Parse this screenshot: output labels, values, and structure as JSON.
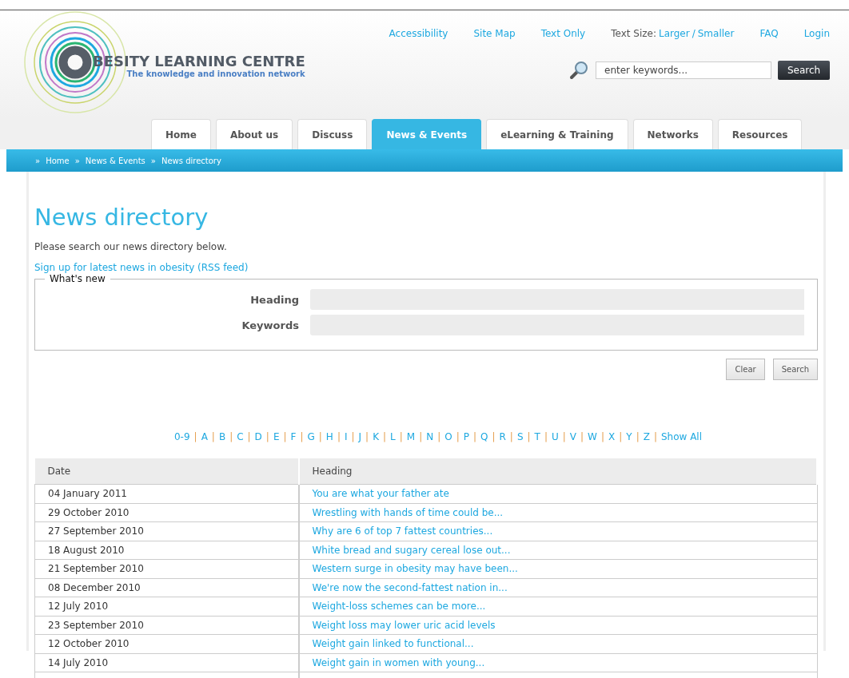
{
  "logo": {
    "name": "BESITY LEARNING CENTRE",
    "tagline": "The knowledge and innovation network"
  },
  "top_links": [
    {
      "kind": "link",
      "text": "Accessibility"
    },
    {
      "kind": "link",
      "text": "Site Map"
    },
    {
      "kind": "link",
      "text": "Text Only"
    },
    {
      "kind": "textsize",
      "text": "Text Size:",
      "larger": "Larger",
      "sep": "/",
      "smaller": "Smaller"
    },
    {
      "kind": "link",
      "text": "FAQ"
    },
    {
      "kind": "link",
      "text": "Login"
    }
  ],
  "site_search": {
    "placeholder": "enter keywords...",
    "button": "Search"
  },
  "tabs": [
    {
      "label": "Home",
      "selected": false
    },
    {
      "label": "About us",
      "selected": false
    },
    {
      "label": "Discuss",
      "selected": false
    },
    {
      "label": "News & Events",
      "selected": true
    },
    {
      "label": "eLearning & Training",
      "selected": false
    },
    {
      "label": "Networks",
      "selected": false
    },
    {
      "label": "Resources",
      "selected": false
    }
  ],
  "breadcrumb": [
    {
      "sep": "»",
      "text": "Home"
    },
    {
      "sep": "»",
      "text": "News & Events"
    },
    {
      "sep": "»",
      "text": "News directory"
    }
  ],
  "page_title": "News directory",
  "intro": "Please search our news directory below.",
  "rss_link": "Sign up for latest news in obesity (RSS feed)",
  "filter": {
    "legend": "What's new",
    "fields": [
      {
        "label": "Heading"
      },
      {
        "label": "Keywords"
      }
    ],
    "buttons": [
      "Clear",
      "Search"
    ]
  },
  "letters": [
    "0-9",
    "A",
    "B",
    "C",
    "D",
    "E",
    "F",
    "G",
    "H",
    "I",
    "J",
    "K",
    "L",
    "M",
    "N",
    "O",
    "P",
    "Q",
    "R",
    "S",
    "T",
    "U",
    "V",
    "W",
    "X",
    "Y",
    "Z",
    "Show All"
  ],
  "letter_sep": "|",
  "table": {
    "columns": [
      "Date",
      "Heading"
    ],
    "rows": [
      {
        "date": "04 January 2011",
        "heading": "You are what your father ate"
      },
      {
        "date": "29 October 2010",
        "heading": "Wrestling with hands of time could be..."
      },
      {
        "date": "27 September 2010",
        "heading": "Why are 6 of top 7 fattest countries..."
      },
      {
        "date": "18 August 2010",
        "heading": "White bread and sugary cereal lose out..."
      },
      {
        "date": "21 September 2010",
        "heading": "Western surge in obesity may have been..."
      },
      {
        "date": "08 December 2010",
        "heading": "We're now the second-fattest nation in..."
      },
      {
        "date": "12 July 2010",
        "heading": "Weight-loss schemes can be more..."
      },
      {
        "date": "23 September 2010",
        "heading": "Weight loss may lower uric acid levels"
      },
      {
        "date": "12 October 2010",
        "heading": "Weight gain linked to functional..."
      },
      {
        "date": "14 July 2010",
        "heading": "Weight gain in women with young..."
      }
    ]
  }
}
